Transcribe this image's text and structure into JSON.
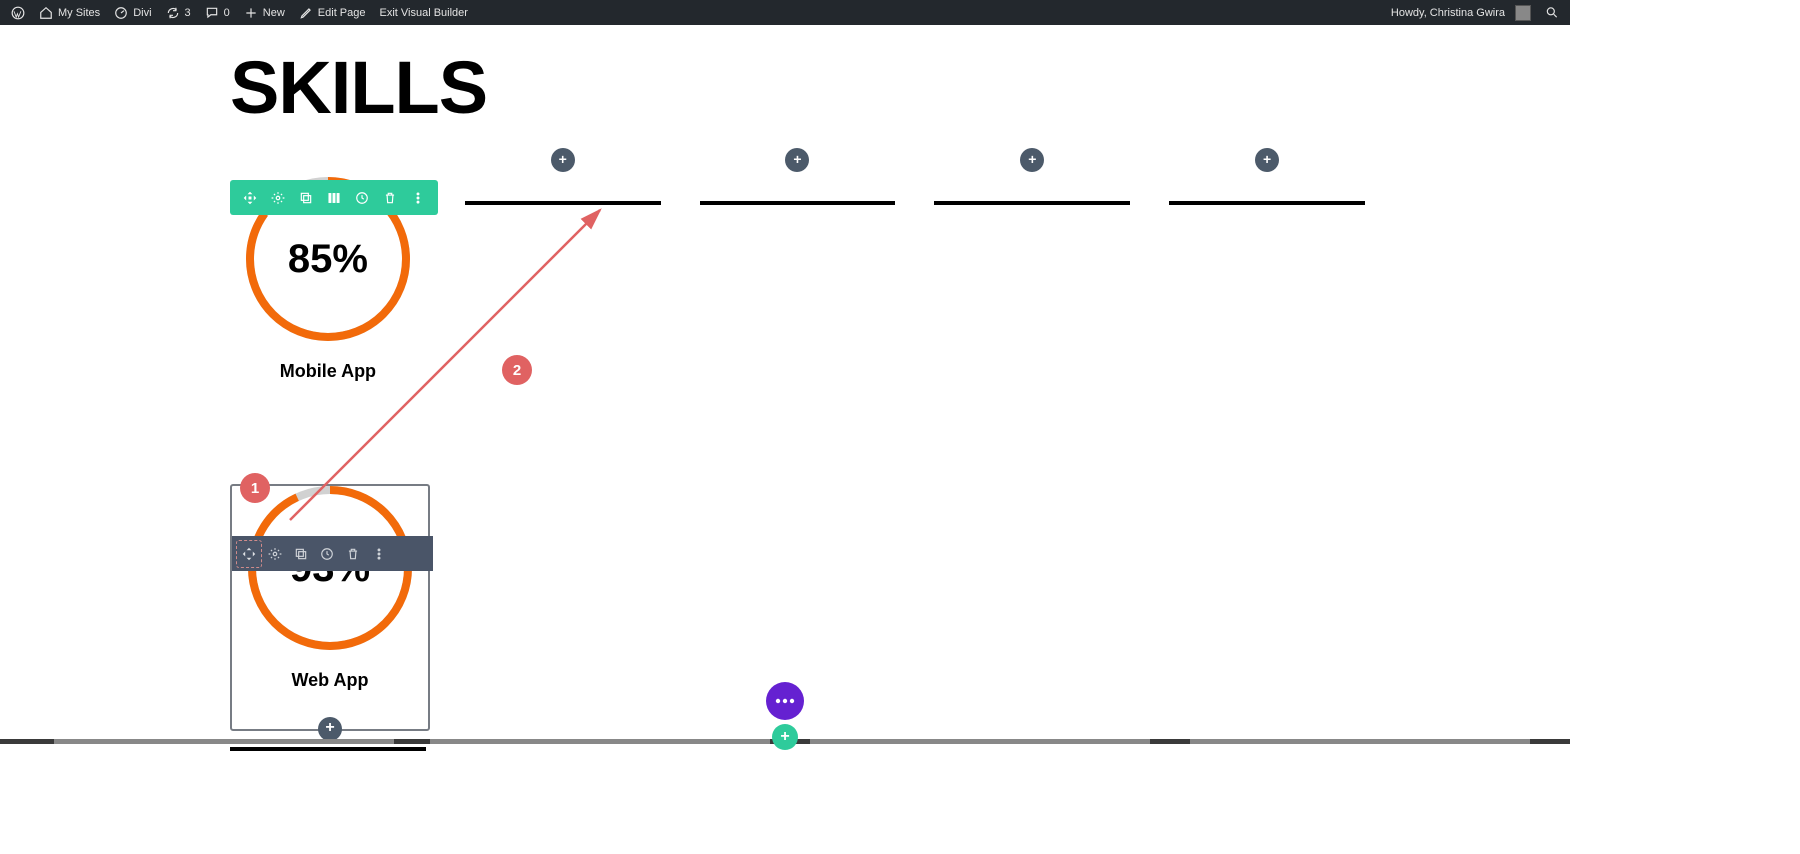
{
  "adminBar": {
    "mySites": "My Sites",
    "divi": "Divi",
    "updates": "3",
    "comments": "0",
    "new": "New",
    "editPage": "Edit Page",
    "exitBuilder": "Exit Visual Builder",
    "howdy": "Howdy, Christina Gwira"
  },
  "title": "SKILLS",
  "counters": {
    "first": {
      "percent": 85,
      "text": "85%",
      "label": "Mobile App"
    },
    "second": {
      "percent": 93,
      "text": "93%",
      "label": "Web App"
    }
  },
  "annotations": {
    "one": "1",
    "two": "2"
  },
  "colors": {
    "accent": "#f26a0a",
    "rowToolbar": "#2ecb9b",
    "modToolbar": "#4a5568",
    "addButton": "#4c5a6a",
    "badge": "#e06262",
    "fab": "#6521d1"
  },
  "chart_data": [
    {
      "type": "pie",
      "title": "Mobile App",
      "values": [
        85,
        15
      ],
      "categories": [
        "filled",
        "remaining"
      ],
      "ylim": [
        0,
        100
      ]
    },
    {
      "type": "pie",
      "title": "Web App",
      "values": [
        93,
        7
      ],
      "categories": [
        "filled",
        "remaining"
      ],
      "ylim": [
        0,
        100
      ]
    }
  ]
}
